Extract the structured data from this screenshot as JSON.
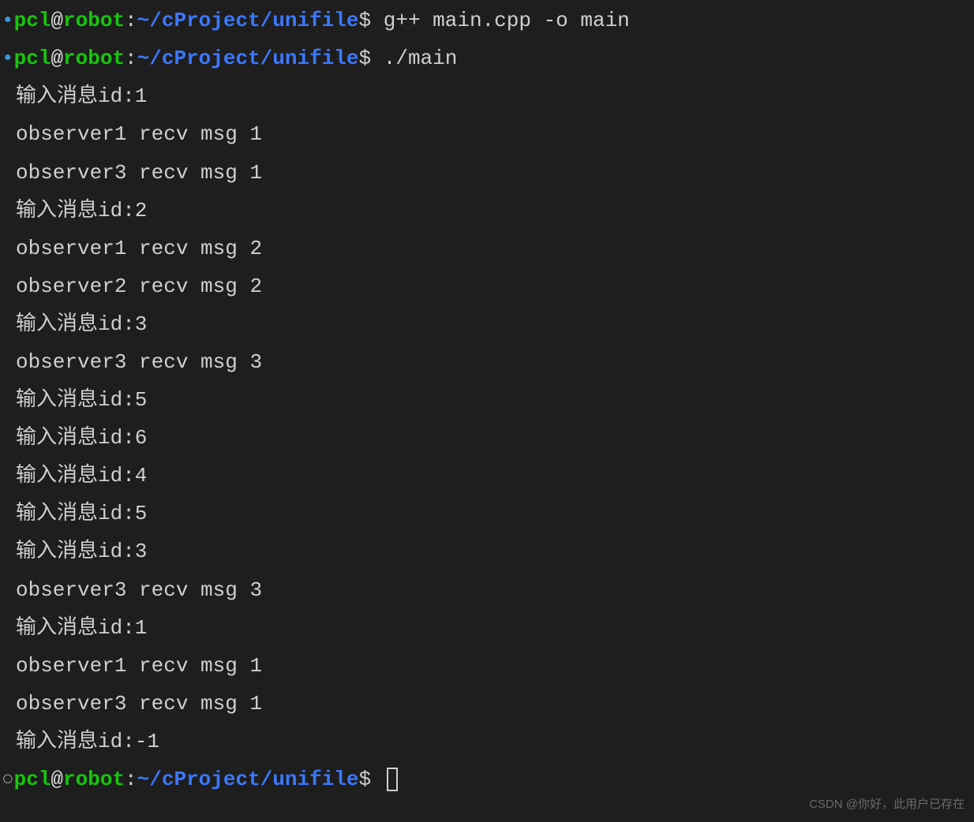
{
  "prompts": [
    {
      "bullet": "filled",
      "user": "pcl",
      "host": "robot",
      "path": "~/cProject/unifile",
      "command": "g++ main.cpp -o main"
    },
    {
      "bullet": "filled",
      "user": "pcl",
      "host": "robot",
      "path": "~/cProject/unifile",
      "command": "./main"
    }
  ],
  "outputs": [
    "输入消息id:1",
    "observer1 recv msg 1",
    "observer3 recv msg 1",
    "输入消息id:2",
    "observer1 recv msg 2",
    "observer2 recv msg 2",
    "输入消息id:3",
    "observer3 recv msg 3",
    "输入消息id:5",
    "输入消息id:6",
    "输入消息id:4",
    "输入消息id:5",
    "输入消息id:3",
    "observer3 recv msg 3",
    "输入消息id:1",
    "observer1 recv msg 1",
    "observer3 recv msg 1",
    "输入消息id:-1"
  ],
  "final_prompt": {
    "bullet": "hollow",
    "user": "pcl",
    "host": "robot",
    "path": "~/cProject/unifile",
    "command": ""
  },
  "watermark": "CSDN @你好，此用户已存在"
}
